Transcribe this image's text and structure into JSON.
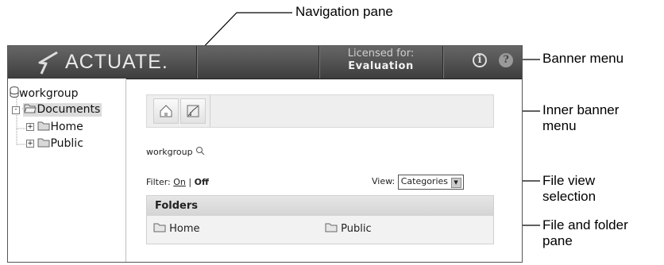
{
  "callouts": {
    "navigation_pane": "Navigation pane",
    "banner_menu": "Banner menu",
    "inner_banner_menu_1": "Inner banner",
    "inner_banner_menu_2": "menu",
    "file_view_1": "File view",
    "file_view_2": "selection",
    "file_folder_1": "File and folder",
    "file_folder_2": "pane"
  },
  "banner": {
    "logo": "ACTUATE.",
    "licensed_label": "Licensed for:",
    "licensed_value": "Evaluation",
    "info_icon": "info-icon",
    "help_icon": "help-icon"
  },
  "nav": {
    "root": "workgroup",
    "documents": "Documents",
    "home": "Home",
    "public": "Public"
  },
  "content": {
    "location": "workgroup",
    "filter_label": "Filter:",
    "filter_on": "On",
    "filter_sep": "|",
    "filter_off": "Off",
    "view_label": "View:",
    "view_value": "Categories",
    "folders_header": "Folders",
    "folders": [
      "Home",
      "Public"
    ]
  },
  "colors": {
    "banner": "#4a4a4a",
    "inner_banner": "#eeeeee",
    "folder_icon": "#d9d9d9"
  }
}
